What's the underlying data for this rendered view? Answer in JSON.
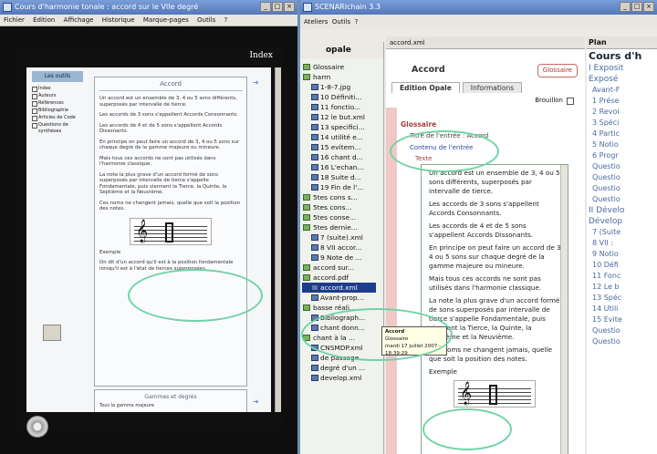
{
  "left_window": {
    "title": "Cours d'harmonie tonale : accord sur le VIIe degré",
    "menu": [
      "Fichier",
      "Édition",
      "Affichage",
      "Historique",
      "Marque-pages",
      "Outils",
      "?"
    ],
    "index_label": "Index",
    "tab_label": "Les outils",
    "nav_items": [
      "Index",
      "Auteurs",
      "Références",
      "Bibliographie",
      "Articles de Code",
      "Questions de synthèses"
    ],
    "doc_heading": "Accord",
    "paragraphs": [
      "Un accord est un ensemble de 3, 4 ou 5 sons différents, superposés par intervalle de tierce.",
      "Les accords de 3 sons s'appellent Accords Consonnants.",
      "Les accords de 4 et de 5 sons s'appellent Accords Dissonants.",
      "En principe on peut faire un accord de 3, 4 ou 5 sons sur chaque degré de la gamme majeure ou mineure.",
      "Mais tous ces accords ne sont pas utilisés dans l'harmonie classique.",
      "La note la plus grave d'un accord formé de sons superposés par intervalle de tierce s'appelle Fondamentale, puis viennent la Tierce, la Quinte, la Septième et la Neuvième.",
      "Ces noms ne changent jamais, quelle que soit la position des notes."
    ],
    "example_label": "Exemple",
    "example_note": "On dit d'un accord qu'il est à la position fondamentale lorsqu'il est à l'état de tierces superposées.",
    "next_heading": "Gammes et degrés",
    "next_text": "Tous la gamme majeure"
  },
  "right_window": {
    "title": "SCENARIchain 3.3",
    "menu": [
      "Ateliers",
      "Outils",
      "?"
    ],
    "nav_title": "opale",
    "tree": [
      {
        "label": "Glossaire",
        "sub": false
      },
      {
        "label": "harm",
        "sub": false
      },
      {
        "label": "1-8-7.jpg",
        "sub": true
      },
      {
        "label": "10 Définiti...",
        "sub": true
      },
      {
        "label": "11 fonctio...",
        "sub": true
      },
      {
        "label": "12 le but.xml",
        "sub": true
      },
      {
        "label": "13 specifici...",
        "sub": true
      },
      {
        "label": "14 utilité e...",
        "sub": true
      },
      {
        "label": "15 evitem...",
        "sub": true
      },
      {
        "label": "16 chant d...",
        "sub": true
      },
      {
        "label": "16 L'echan...",
        "sub": true
      },
      {
        "label": "18 Suite d...",
        "sub": true
      },
      {
        "label": "19 Fin de l'...",
        "sub": true
      },
      {
        "label": "5tes cons s...",
        "sub": false
      },
      {
        "label": "5tes cons...",
        "sub": false
      },
      {
        "label": "5tes conse...",
        "sub": false
      },
      {
        "label": "5tes dernie...",
        "sub": false
      },
      {
        "label": "7 (suite).xml",
        "sub": true
      },
      {
        "label": "8 VII accor...",
        "sub": true
      },
      {
        "label": "9 Note de ...",
        "sub": true
      },
      {
        "label": "accord sur...",
        "sub": false
      },
      {
        "label": "accord.pdf",
        "sub": false
      },
      {
        "label": "accord.xml",
        "sub": true,
        "selected": true
      },
      {
        "label": "Avant-prop...",
        "sub": true
      },
      {
        "label": "basse réali...",
        "sub": false
      },
      {
        "label": "Bibliograph...",
        "sub": true
      },
      {
        "label": "chant donn...",
        "sub": true
      },
      {
        "label": "chant à la ...",
        "sub": false
      },
      {
        "label": "CNSMDP.xml",
        "sub": true
      },
      {
        "label": "de passage...",
        "sub": true
      },
      {
        "label": "degré d'un ...",
        "sub": true
      },
      {
        "label": "develop.xml",
        "sub": true
      }
    ],
    "file_tab": "accord.xml",
    "item_title": "Accord",
    "item_type": "Glossaire",
    "edit_tabs": [
      "Edition Opale",
      "Informations"
    ],
    "draft_label": "Brouillon",
    "glossary_heading": "Glossaire",
    "entry_title_label": "Titre de l'entrée : Accord",
    "entry_content_label": "Contenu de l'entrée",
    "text_label": "Texte",
    "paragraphs": [
      "Un accord est un ensemble de 3, 4 ou 5 sons différents, superposés par intervalle de tierce.",
      "Les accords de 3 sons s'appellent Accords Consonnants.",
      "Les accords de 4 et de 5 sons s'appellent Accords Dissonants.",
      "En principe on peut faire un accord de 3, 4 ou 5 sons sur chaque degré de la gamme majeure ou mineure.",
      "Mais tous ces accords ne sont pas utilisés dans l'harmonie classique.",
      "La note la plus grave d'un accord formé de sons superposés par intervalle de tierce s'appelle Fondamentale, puis viennent la Tierce, la Quinte, la Septième et la Neuvième.",
      "Ces noms ne changent jamais, quelle que soit la position des notes.",
      "Exemple"
    ],
    "tooltip": {
      "title": "Accord",
      "type": "Glossaire",
      "date": "mardi 17 juillet 2007 - 18:39:29"
    },
    "plan_title": "Plan",
    "plan_items": [
      {
        "label": "Cours d'h",
        "level": "b"
      },
      {
        "label": "I Exposit",
        "level": "l1"
      },
      {
        "label": "Exposé",
        "level": "l1"
      },
      {
        "label": "Avant-F",
        "level": "l2"
      },
      {
        "label": "1 Prése",
        "level": "l2"
      },
      {
        "label": "2 Revoi",
        "level": "l2"
      },
      {
        "label": "3 Spéci",
        "level": "l2"
      },
      {
        "label": "4 Partic",
        "level": "l2"
      },
      {
        "label": "5 Notio",
        "level": "l2"
      },
      {
        "label": "6 Progr",
        "level": "l2"
      },
      {
        "label": "Questio",
        "level": "l2"
      },
      {
        "label": "Questio",
        "level": "l2"
      },
      {
        "label": "Questio",
        "level": "l2"
      },
      {
        "label": "Questio",
        "level": "l2"
      },
      {
        "label": "II Dévelo",
        "level": "l1"
      },
      {
        "label": "Dévelop",
        "level": "l1"
      },
      {
        "label": "7 (Suite",
        "level": "l2"
      },
      {
        "label": "8 VII :",
        "level": "l2"
      },
      {
        "label": "9 Notio",
        "level": "l2"
      },
      {
        "label": "10 Défi",
        "level": "l2"
      },
      {
        "label": "11 Fonc",
        "level": "l2"
      },
      {
        "label": "12 Le b",
        "level": "l2"
      },
      {
        "label": "13 Spéc",
        "level": "l2"
      },
      {
        "label": "14 Utili",
        "level": "l2"
      },
      {
        "label": "15 Evite",
        "level": "l2"
      },
      {
        "label": "Questio",
        "level": "l2"
      },
      {
        "label": "Questio",
        "level": "l2"
      }
    ]
  }
}
